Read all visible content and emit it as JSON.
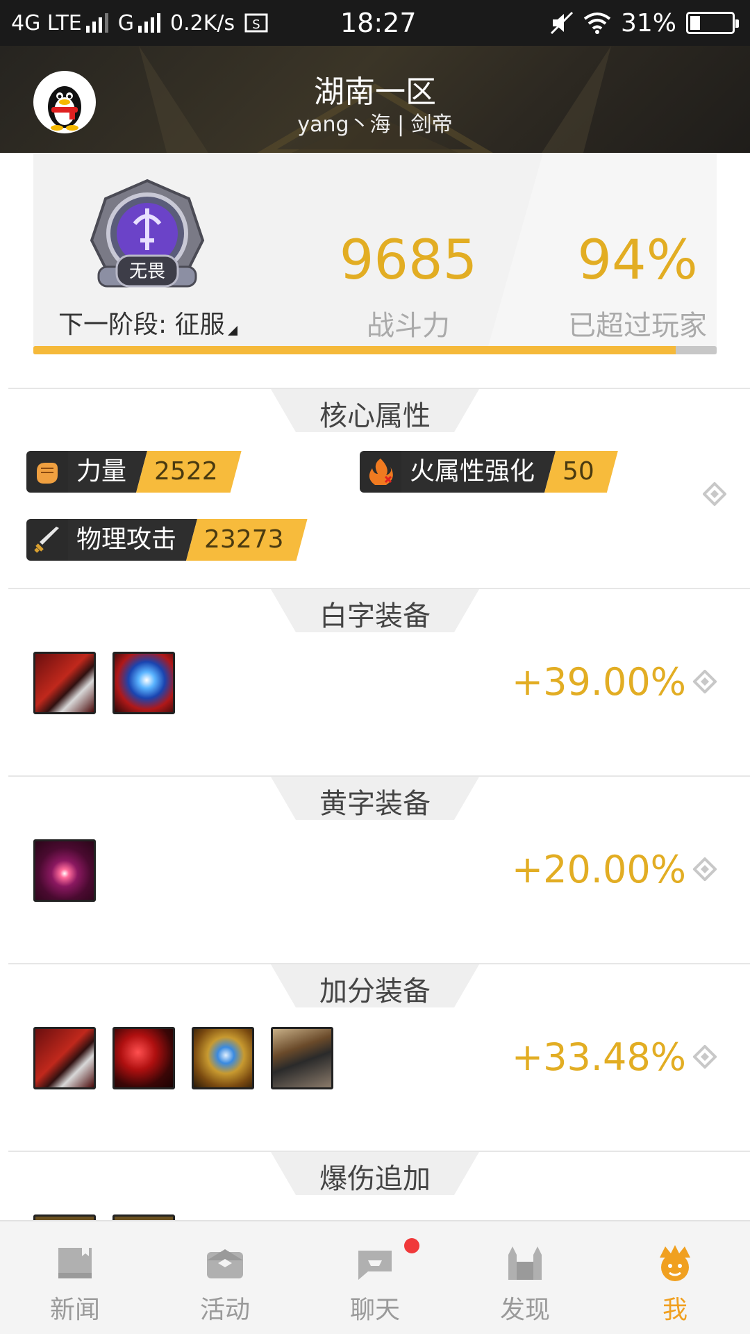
{
  "status_bar": {
    "network": "4G LTE",
    "network2": "G",
    "speed": "0.2K/s",
    "time": "18:27",
    "battery": "31%",
    "battery_level": 0.31
  },
  "header": {
    "server": "湖南一区",
    "player": "yang丶海 | 剑帝"
  },
  "power_card": {
    "rank_badge_text": "无畏",
    "next_stage": "下一阶段: 征服",
    "power_value": "9685",
    "power_label": "战斗力",
    "percent_value": "94%",
    "percent_label": "已超过玩家",
    "progress": 0.94
  },
  "sections": {
    "core": {
      "title": "核心属性",
      "attributes": [
        {
          "name": "力量",
          "value": "2522",
          "icon": "fist-icon"
        },
        {
          "name": "火属性强化",
          "value": "50",
          "icon": "fire-icon"
        },
        {
          "name": "物理攻击",
          "value": "23273",
          "icon": "sword-icon"
        }
      ]
    },
    "white": {
      "title": "白字装备",
      "percent": "+39.00%"
    },
    "yellow": {
      "title": "黄字装备",
      "percent": "+20.00%"
    },
    "bonus": {
      "title": "加分装备",
      "percent": "+33.48%"
    },
    "crit": {
      "title": "爆伤追加"
    }
  },
  "bottom_nav": [
    {
      "label": "新闻",
      "icon": "news-icon",
      "active": false
    },
    {
      "label": "活动",
      "icon": "activity-icon",
      "active": false
    },
    {
      "label": "聊天",
      "icon": "chat-icon",
      "active": false,
      "badge": true
    },
    {
      "label": "发现",
      "icon": "discover-icon",
      "active": false
    },
    {
      "label": "我",
      "icon": "me-icon",
      "active": true
    }
  ],
  "colors": {
    "accent_gold": "#e2ad23",
    "tag_yellow": "#f7bb3c",
    "active_nav": "#f0a020",
    "badge_red": "#f0393a"
  }
}
